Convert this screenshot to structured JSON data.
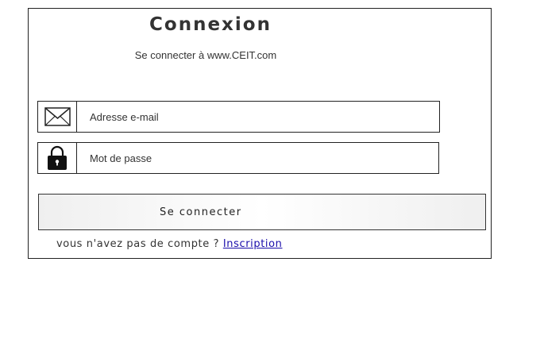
{
  "login": {
    "title": "Connexion",
    "subtitle": "Se connecter à www.CEIT.com",
    "email": {
      "placeholder": "Adresse e-mail",
      "value": "",
      "icon": "envelope-icon"
    },
    "password": {
      "placeholder": "Mot de passe",
      "value": "",
      "icon": "lock-icon"
    },
    "submit_label": "Se connecter",
    "signup_prompt": "vous n'avez pas de compte ?",
    "signup_link": " Inscription"
  }
}
